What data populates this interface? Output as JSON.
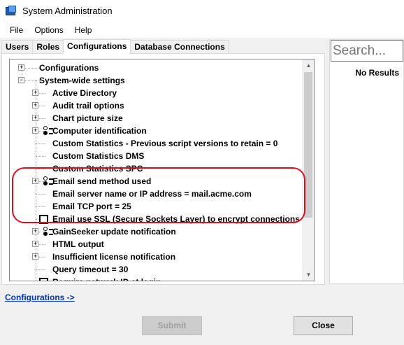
{
  "window": {
    "title": "System Administration"
  },
  "menu": {
    "items": [
      "File",
      "Options",
      "Help"
    ]
  },
  "tabs": [
    {
      "label": "Users",
      "active": false
    },
    {
      "label": "Roles",
      "active": false
    },
    {
      "label": "Configurations",
      "active": true
    },
    {
      "label": "Database Connections",
      "active": false
    }
  ],
  "tree": {
    "items": [
      {
        "label": "Configurations",
        "expander": "+",
        "icon": "none"
      },
      {
        "label": "System-wide settings",
        "expander": "-",
        "icon": "none"
      },
      {
        "label": "Active Directory",
        "expander": "+",
        "icon": "none"
      },
      {
        "label": "Audit trail options",
        "expander": "+",
        "icon": "none"
      },
      {
        "label": "Chart picture size",
        "expander": "+",
        "icon": "none"
      },
      {
        "label": "Computer identification",
        "expander": "+",
        "icon": "radio-options-icon"
      },
      {
        "label": "Custom Statistics - Previous script versions to retain = 0",
        "expander": "",
        "icon": "none"
      },
      {
        "label": "Custom Statistics DMS",
        "expander": "",
        "icon": "none"
      },
      {
        "label": "Custom Statistics SPC",
        "expander": "",
        "icon": "none"
      },
      {
        "label": "Email send method used",
        "expander": "+",
        "icon": "radio-options-icon"
      },
      {
        "label": "Email server name or IP address = mail.acme.com",
        "expander": "",
        "icon": "none"
      },
      {
        "label": "Email TCP port = 25",
        "expander": "",
        "icon": "none"
      },
      {
        "label": "Email use SSL (Secure Sockets Layer) to encrypt connections",
        "expander": "",
        "icon": "checkbox-icon"
      },
      {
        "label": "GainSeeker update notification",
        "expander": "+",
        "icon": "radio-options-icon"
      },
      {
        "label": "HTML output",
        "expander": "+",
        "icon": "none"
      },
      {
        "label": "Insufficient license notification",
        "expander": "+",
        "icon": "none"
      },
      {
        "label": "Query timeout = 30",
        "expander": "",
        "icon": "none"
      },
      {
        "label": "Require network ID at login",
        "expander": "",
        "icon": "checkbox-icon"
      }
    ]
  },
  "search": {
    "placeholder": "Search...",
    "no_results": "No Results"
  },
  "footer": {
    "link": "Configurations ->",
    "submit_label": "Submit",
    "close_label": "Close"
  },
  "colors": {
    "highlight": "#e0101a",
    "link": "#0033cc"
  }
}
